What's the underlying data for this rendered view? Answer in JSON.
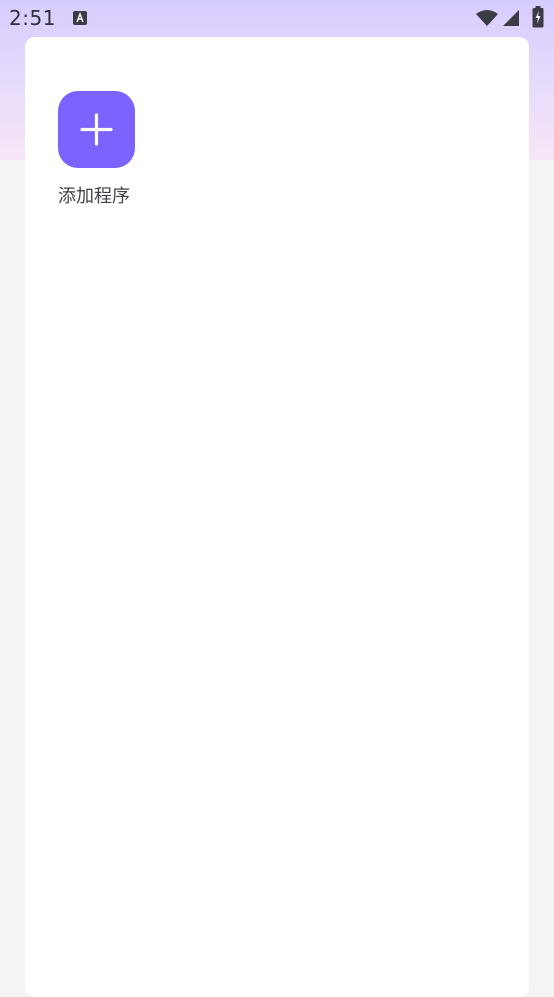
{
  "status_bar": {
    "time": "2:51",
    "notification_icon": "a-icon",
    "wifi_icon": "wifi-icon",
    "signal_icon": "cellular-signal-icon",
    "battery_icon": "battery-charging-icon"
  },
  "panel": {
    "add_app": {
      "icon": "plus-icon",
      "label": "添加程序"
    }
  },
  "colors": {
    "accent": "#7b63ff",
    "background": "#f4f4f5",
    "header_gradient_top": "#d7ccff",
    "header_gradient_bottom": "#f7e6f7"
  }
}
